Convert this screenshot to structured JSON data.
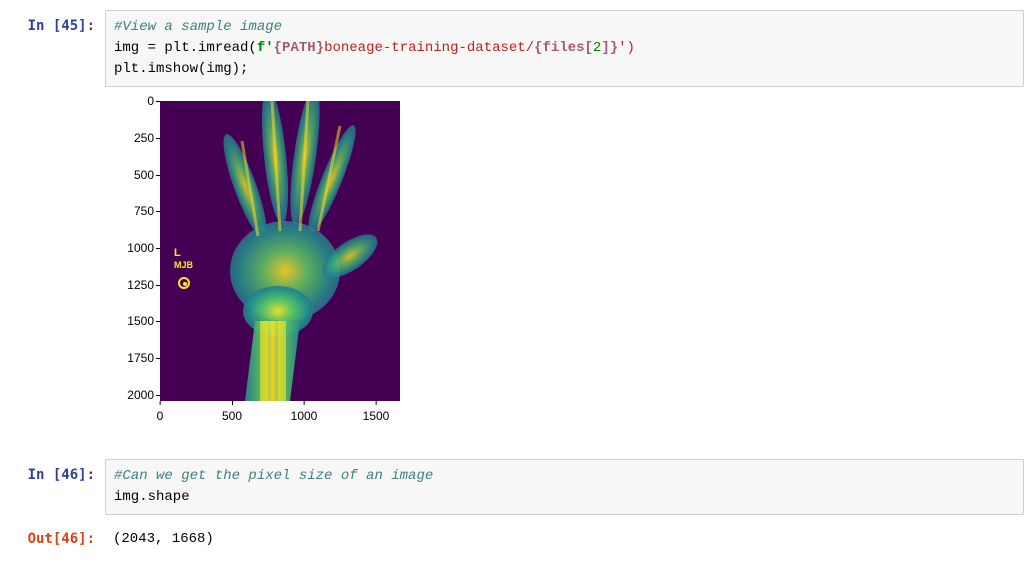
{
  "cells": {
    "c45": {
      "prompt_in": "In [45]:",
      "comment": "#View a sample image",
      "line2_pre": "img = plt.imread(",
      "line2_f": "f'",
      "line2_path": "{PATH}",
      "line2_mid": "boneage-training-dataset/",
      "line2_files": "{files[",
      "line2_idx": "2",
      "line2_close_interp": "]}",
      "line2_end": "')",
      "line3": "plt.imshow(img);"
    },
    "c46": {
      "prompt_in": "In [46]:",
      "comment": "#Can we get the pixel size of an image",
      "line2": "img.shape",
      "prompt_out": "Out[46]:",
      "output": "(2043, 1668)"
    }
  },
  "chart_data": {
    "type": "image",
    "y_ticks": [
      "0",
      "250",
      "500",
      "750",
      "1000",
      "1250",
      "1500",
      "1750",
      "2000"
    ],
    "x_ticks": [
      "0",
      "500",
      "1000",
      "1500"
    ],
    "xlim": [
      0,
      1668
    ],
    "ylim": [
      0,
      2043
    ],
    "colormap": "viridis",
    "marker_line1": "L",
    "marker_line2": "MJB"
  }
}
